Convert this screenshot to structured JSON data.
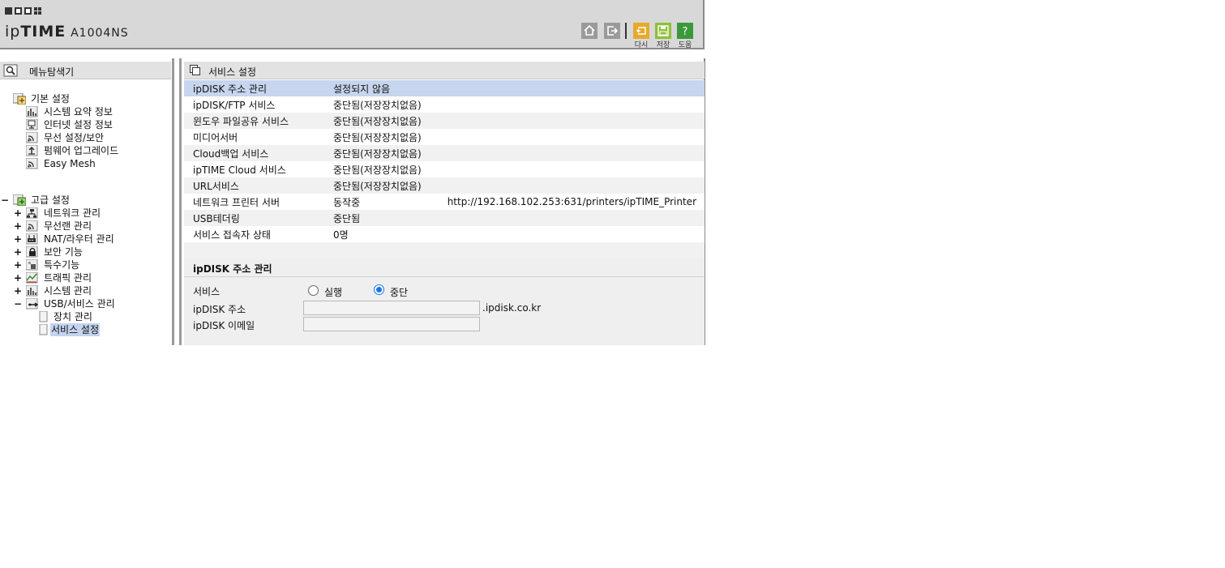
{
  "header": {
    "brand_ip": "ip",
    "brand_time": "TIME",
    "model": "A1004NS",
    "toolbar": {
      "home_icon": "home-icon",
      "logout_icon": "logout-icon",
      "reload_label": "다시",
      "save_label": "저장",
      "help_label": "도움",
      "reload_color": "#e8a92a",
      "save_color": "#8fbf3a",
      "help_color": "#3a9a3a"
    }
  },
  "sidebar": {
    "title": "메뉴탐색기",
    "basic": {
      "label": "기본 설정",
      "items": [
        "시스템 요약 정보",
        "인터넷 설정 정보",
        "무선 설정/보안",
        "펌웨어 업그레이드",
        "Easy Mesh"
      ]
    },
    "advanced": {
      "toggle": "−",
      "label": "고급 설정",
      "items": [
        {
          "toggle": "+",
          "label": "네트워크 관리"
        },
        {
          "toggle": "+",
          "label": "무선랜 관리"
        },
        {
          "toggle": "+",
          "label": "NAT/라우터 관리"
        },
        {
          "toggle": "+",
          "label": "보안 기능"
        },
        {
          "toggle": "+",
          "label": "특수기능"
        },
        {
          "toggle": "+",
          "label": "트래픽 관리"
        },
        {
          "toggle": "+",
          "label": "시스템 관리"
        },
        {
          "toggle": "−",
          "label": "USB/서비스 관리"
        }
      ],
      "usb_children": [
        "장치 관리",
        "서비스 설정"
      ]
    },
    "selected_color": "#c4d3ee"
  },
  "main": {
    "title": "서비스 설정",
    "rows": [
      {
        "name": "ipDISK 주소 관리",
        "status": "설정되지 않음",
        "extra": ""
      },
      {
        "name": "ipDISK/FTP 서비스",
        "status": "중단됨(저장장치없음)",
        "extra": ""
      },
      {
        "name": "윈도우 파일공유 서비스",
        "status": "중단됨(저장장치없음)",
        "extra": ""
      },
      {
        "name": "미디어서버",
        "status": "중단됨(저장장치없음)",
        "extra": ""
      },
      {
        "name": "Cloud백업 서비스",
        "status": "중단됨(저장장치없음)",
        "extra": ""
      },
      {
        "name": "ipTIME Cloud 서비스",
        "status": "중단됨(저장장치없음)",
        "extra": ""
      },
      {
        "name": "URL서비스",
        "status": "중단됨(저장장치없음)",
        "extra": ""
      },
      {
        "name": "네트워크 프린터 서버",
        "status": "동작중",
        "extra": "http://192.168.102.253:631/printers/ipTIME_Printer"
      },
      {
        "name": "USB테더링",
        "status": "중단됨",
        "extra": ""
      },
      {
        "name": "서비스 접속자 상태",
        "status": "0명",
        "extra": ""
      }
    ],
    "section": {
      "title": "ipDISK 주소 관리",
      "service_label": "서비스",
      "run_label": "실행",
      "stop_label": "중단",
      "selected": "중단",
      "address_label": "ipDISK 주소",
      "address_value": "",
      "domain_suffix": ".ipdisk.co.kr",
      "email_label": "ipDISK 이메일",
      "email_value": ""
    },
    "highlight_color": "#c7d5ee"
  }
}
